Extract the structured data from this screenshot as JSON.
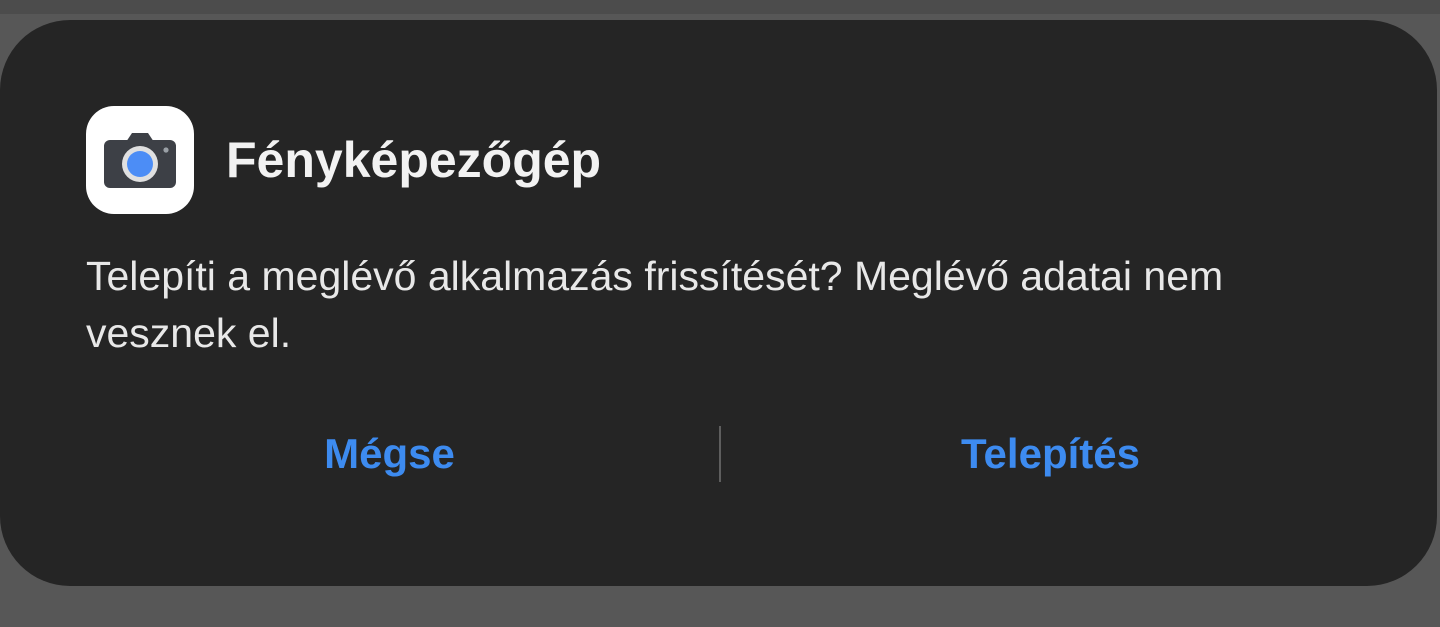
{
  "dialog": {
    "app_name": "Fényképezőgép",
    "app_icon": "camera-icon",
    "message": "Telepíti a meglévő alkalmazás frissítését? Meglévő adatai nem vesznek el.",
    "buttons": {
      "cancel_label": "Mégse",
      "install_label": "Telepítés"
    }
  },
  "colors": {
    "dialog_background": "#252525",
    "page_background": "#575757",
    "accent": "#3d8bf0",
    "text": "#e8e8e8"
  }
}
